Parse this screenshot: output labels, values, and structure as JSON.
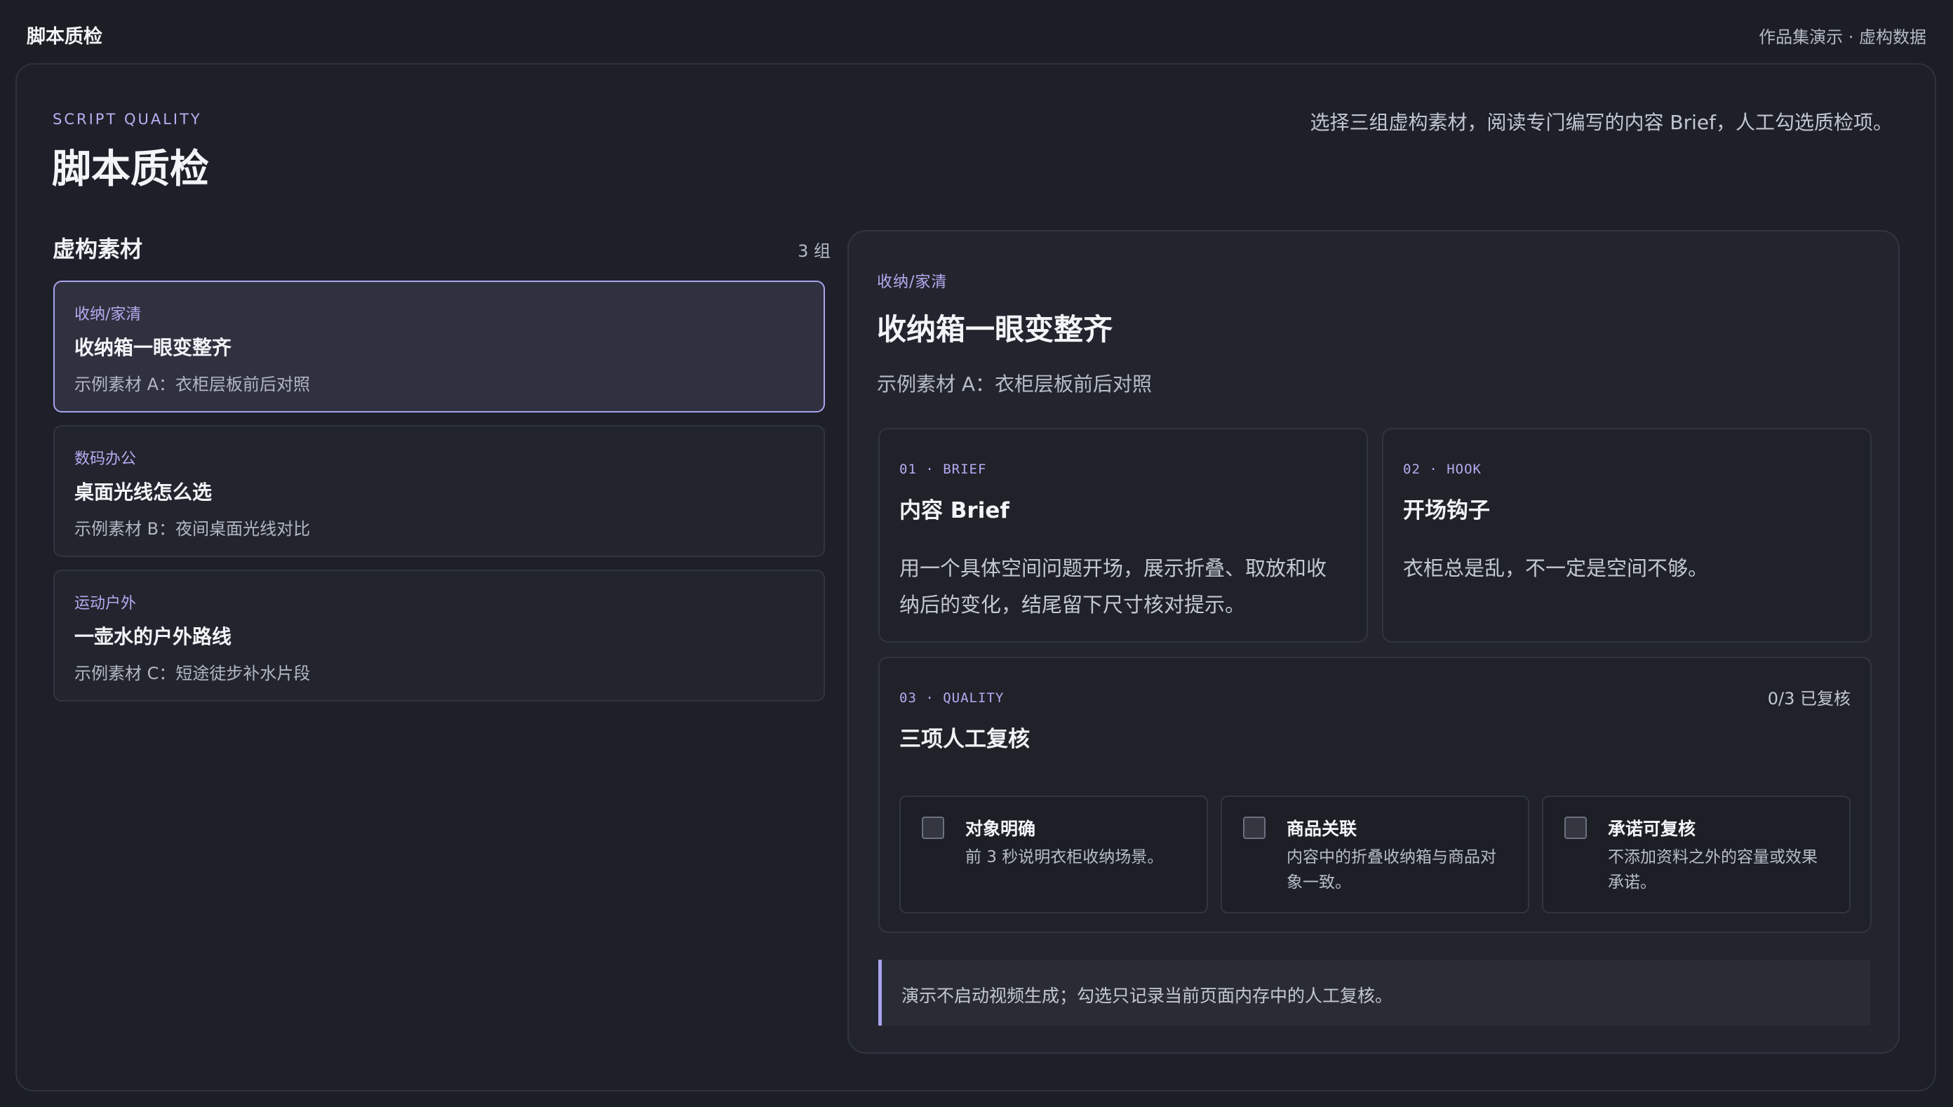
{
  "app": {
    "title": "脚本质检",
    "meta": "作品集演示 · 虚构数据"
  },
  "header": {
    "eyebrow": "SCRIPT QUALITY",
    "title": "脚本质检",
    "intro": "选择三组虚构素材，阅读专门编写的内容 Brief，人工勾选质检项。"
  },
  "list": {
    "title": "虚构素材",
    "count": "3 组",
    "items": [
      {
        "category": "收纳/家清",
        "title": "收纳箱一眼变整齐",
        "subtitle": "示例素材 A：衣柜层板前后对照",
        "selected": true
      },
      {
        "category": "数码办公",
        "title": "桌面光线怎么选",
        "subtitle": "示例素材 B：夜间桌面光线对比",
        "selected": false
      },
      {
        "category": "运动户外",
        "title": "一壶水的户外路线",
        "subtitle": "示例素材 C：短途徒步补水片段",
        "selected": false
      }
    ]
  },
  "detail": {
    "category": "收纳/家清",
    "title": "收纳箱一眼变整齐",
    "subtitle": "示例素材 A：衣柜层板前后对照",
    "brief": {
      "label": "01 · BRIEF",
      "title": "内容 Brief",
      "body": "用一个具体空间问题开场，展示折叠、取放和收纳后的变化，结尾留下尺寸核对提示。"
    },
    "hook": {
      "label": "02 · HOOK",
      "title": "开场钩子",
      "body": "衣柜总是乱，不一定是空间不够。"
    },
    "quality": {
      "label": "03 · QUALITY",
      "title": "三项人工复核",
      "status": "0/3 已复核",
      "checks": [
        {
          "title": "对象明确",
          "desc": "前 3 秒说明衣柜收纳场景。",
          "checked": false
        },
        {
          "title": "商品关联",
          "desc": "内容中的折叠收纳箱与商品对象一致。",
          "checked": false
        },
        {
          "title": "承诺可复核",
          "desc": "不添加资料之外的容量或效果承诺。",
          "checked": false
        }
      ]
    },
    "note": "演示不启动视频生成；勾选只记录当前页面内存中的人工复核。"
  },
  "colors": {
    "background": "#1b1e25",
    "panel": "#22252d",
    "accent": "#a9a3ee",
    "accent_text": "#b3acf2",
    "border": "#31353f"
  }
}
